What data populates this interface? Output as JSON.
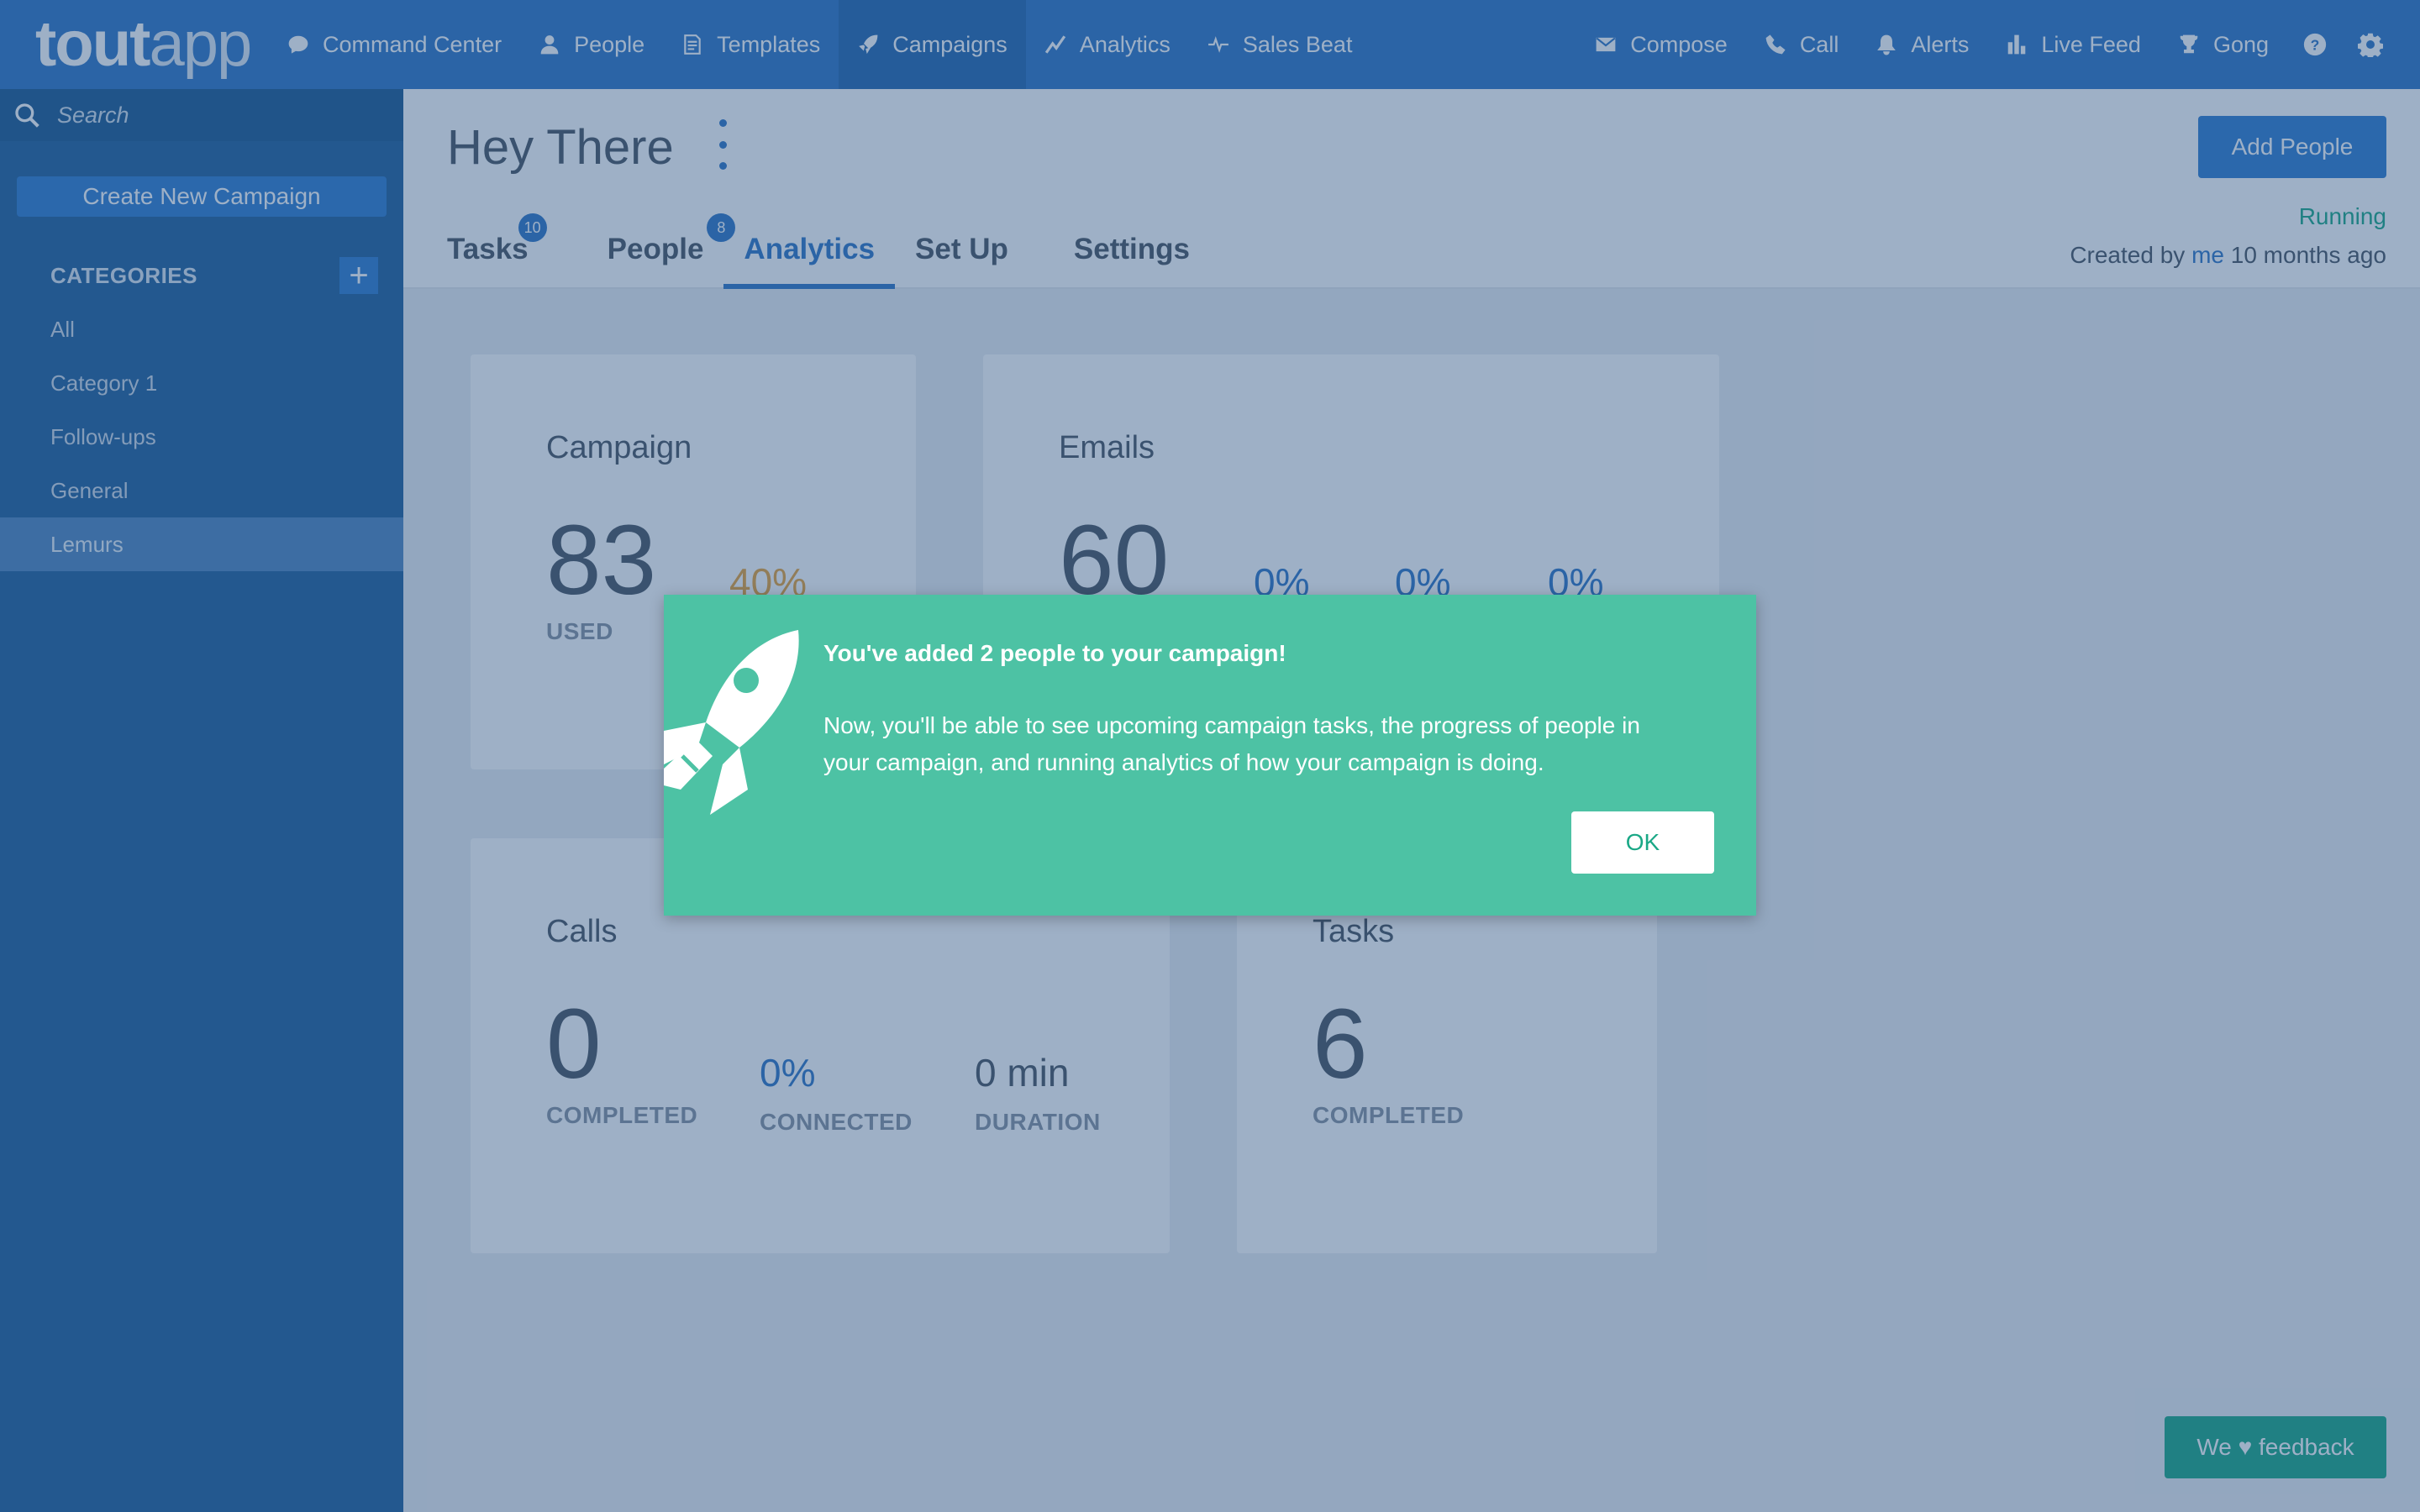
{
  "logo": {
    "tout": "tout",
    "app": "app"
  },
  "nav": {
    "left": [
      {
        "label": "Command Center",
        "icon": "chat-bubble-icon"
      },
      {
        "label": "People",
        "icon": "person-icon"
      },
      {
        "label": "Templates",
        "icon": "document-icon"
      },
      {
        "label": "Campaigns",
        "icon": "rocket-icon",
        "active": true
      },
      {
        "label": "Analytics",
        "icon": "line-chart-icon"
      },
      {
        "label": "Sales Beat",
        "icon": "pulse-icon"
      }
    ],
    "right": [
      {
        "label": "Compose",
        "icon": "envelope-icon"
      },
      {
        "label": "Call",
        "icon": "phone-icon"
      },
      {
        "label": "Alerts",
        "icon": "bell-icon"
      },
      {
        "label": "Live Feed",
        "icon": "bar-chart-icon"
      },
      {
        "label": "Gong",
        "icon": "trophy-icon"
      },
      {
        "label": "",
        "icon": "help-icon"
      },
      {
        "label": "",
        "icon": "gear-icon"
      }
    ]
  },
  "sidebar": {
    "search_placeholder": "Search",
    "create_button": "Create New Campaign",
    "categories_title": "CATEGORIES",
    "add_symbol": "+",
    "categories": [
      {
        "label": "All"
      },
      {
        "label": "Category 1"
      },
      {
        "label": "Follow-ups"
      },
      {
        "label": "General"
      },
      {
        "label": "Lemurs",
        "active": true
      }
    ]
  },
  "header": {
    "title": "Hey There",
    "add_people": "Add People",
    "status": "Running",
    "created_prefix": "Created by",
    "created_by": "me",
    "created_suffix": "10 months ago",
    "tabs": [
      {
        "label": "Tasks",
        "badge": "10"
      },
      {
        "label": "People",
        "badge": "8"
      },
      {
        "label": "Analytics",
        "active": true
      },
      {
        "label": "Set Up"
      },
      {
        "label": "Settings"
      }
    ]
  },
  "cards": {
    "campaign": {
      "title": "Campaign",
      "used_value": "83",
      "used_label": "USED",
      "pct": "40%"
    },
    "emails": {
      "title": "Emails",
      "value": "60",
      "pct1": "0%",
      "pct2": "0%",
      "pct3": "0%"
    },
    "calls": {
      "title": "Calls",
      "completed_value": "0",
      "completed_label": "COMPLETED",
      "connected_value": "0%",
      "connected_label": "CONNECTED",
      "duration_value": "0 min",
      "duration_label": "DURATION"
    },
    "tasks": {
      "title": "Tasks",
      "completed_value": "6",
      "completed_label": "COMPLETED"
    }
  },
  "feedback": {
    "prefix": "We",
    "heart": "♥",
    "suffix": "feedback"
  },
  "modal": {
    "title": "You've added 2 people to your campaign!",
    "body": "Now, you'll be able to see upcoming campaign tasks, the progress of people in your campaign, and running analytics of how your campaign is doing.",
    "ok": "OK"
  },
  "colors": {
    "brand_blue": "#2e76c5",
    "success_green": "#1aa886",
    "modal_green": "#4dc2a4",
    "warning_orange": "#e8a23a"
  }
}
